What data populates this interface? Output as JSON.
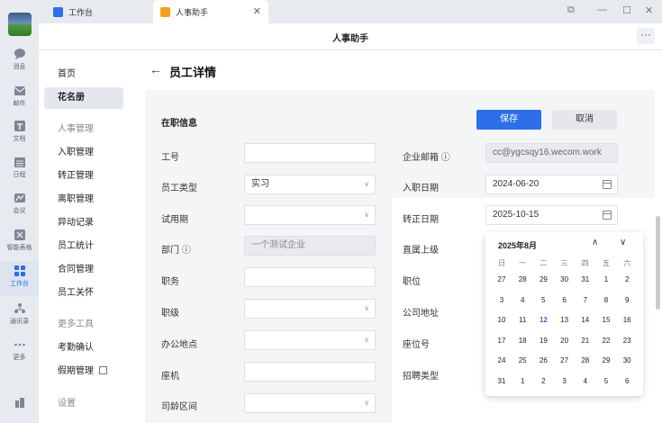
{
  "tabs": [
    {
      "label": "工作台"
    },
    {
      "label": "人事助手"
    }
  ],
  "window_controls": [
    "⧉",
    "—",
    "☐",
    "✕"
  ],
  "app_title": "人事助手",
  "rail": [
    {
      "label": "消息",
      "icon": "chat-icon"
    },
    {
      "label": "邮件",
      "icon": "mail-icon"
    },
    {
      "label": "文档",
      "icon": "doc-icon"
    },
    {
      "label": "日程",
      "icon": "calendar-icon"
    },
    {
      "label": "会议",
      "icon": "meeting-icon"
    },
    {
      "label": "智能表格",
      "icon": "sheet-icon"
    },
    {
      "label": "工作台",
      "icon": "grid-icon",
      "active": true
    },
    {
      "label": "通讯录",
      "icon": "contacts-icon"
    },
    {
      "label": "更多",
      "icon": "more-icon"
    }
  ],
  "nav": {
    "home": "首页",
    "roster": "花名册",
    "hr_group": "人事管理",
    "onboard": "入职管理",
    "regular": "转正管理",
    "leave": "离职管理",
    "change": "异动记录",
    "stats": "员工统计",
    "contract": "合同管理",
    "care": "员工关怀",
    "tools_group": "更多工具",
    "attendance": "考勤确认",
    "vacation": "假期管理",
    "settings": "设置"
  },
  "page_title": "员工详情",
  "section_title": "在职信息",
  "buttons": {
    "save": "保存",
    "cancel": "取消"
  },
  "left_fields": {
    "id": {
      "label": "工号",
      "value": ""
    },
    "type": {
      "label": "员工类型",
      "value": "实习"
    },
    "probation": {
      "label": "试用期",
      "value": ""
    },
    "dept": {
      "label": "部门 ⓘ",
      "value": "一个测试企业"
    },
    "duty": {
      "label": "职务",
      "value": ""
    },
    "rank": {
      "label": "职级",
      "value": ""
    },
    "office": {
      "label": "办公地点",
      "value": ""
    },
    "phone": {
      "label": "座机",
      "value": ""
    },
    "tenure": {
      "label": "司龄区间",
      "value": ""
    }
  },
  "right_fields": {
    "email": {
      "label": "企业邮箱 ⓘ",
      "value": "cc@ygcsqy16.wecom.work"
    },
    "join": {
      "label": "入职日期",
      "value": "2024-06-20"
    },
    "regular": {
      "label": "转正日期",
      "value": "2025-10-15"
    },
    "leader": {
      "label": "直属上级"
    },
    "position": {
      "label": "职位"
    },
    "address": {
      "label": "公司地址"
    },
    "seat": {
      "label": "座位号"
    },
    "recruit": {
      "label": "招聘类型"
    }
  },
  "calendar": {
    "title": "2025年8月",
    "prev": "‹",
    "next": "›",
    "weekdays": [
      "日",
      "一",
      "二",
      "三",
      "四",
      "五",
      "六"
    ],
    "weeks": [
      [
        "27",
        "28",
        "29",
        "30",
        "31",
        "1",
        "2"
      ],
      [
        "3",
        "4",
        "5",
        "6",
        "7",
        "8",
        "9"
      ],
      [
        "10",
        "11",
        "12",
        "13",
        "14",
        "15",
        "16"
      ],
      [
        "17",
        "18",
        "19",
        "20",
        "21",
        "22",
        "23"
      ],
      [
        "24",
        "25",
        "26",
        "27",
        "28",
        "29",
        "30"
      ],
      [
        "31",
        "1",
        "2",
        "3",
        "4",
        "5",
        "6"
      ]
    ],
    "selected": "12"
  }
}
